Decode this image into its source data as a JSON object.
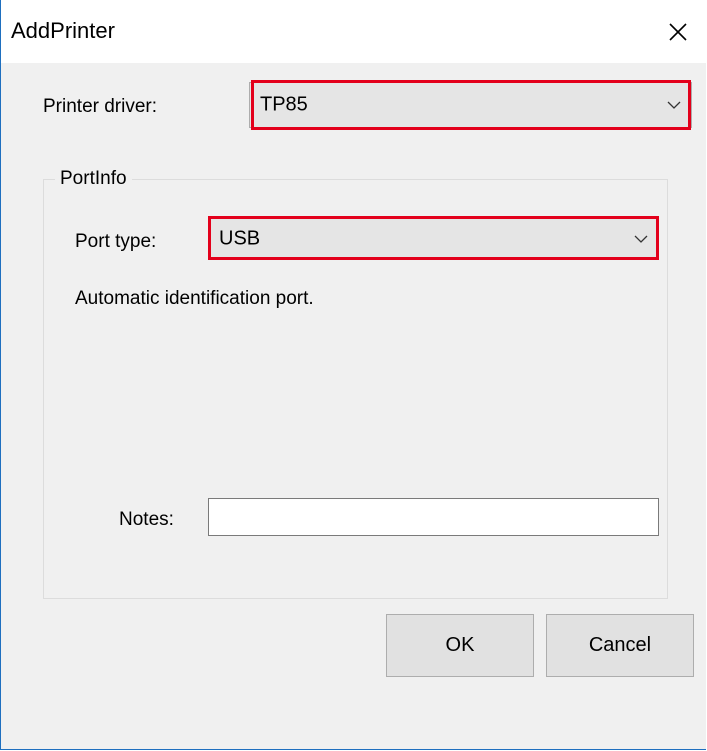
{
  "window": {
    "title": "AddPrinter"
  },
  "printer_driver": {
    "label": "Printer driver:",
    "value": "TP85"
  },
  "port_info": {
    "legend": "PortInfo",
    "port_type_label": "Port type:",
    "port_type_value": "USB",
    "info_text": "Automatic identification port.",
    "notes_label": "Notes:",
    "notes_value": ""
  },
  "buttons": {
    "ok_label": "OK",
    "cancel_label": "Cancel"
  },
  "colors": {
    "highlight": "#e3001b",
    "window_border": "#1e6fbf",
    "background": "#f0f0f0"
  }
}
